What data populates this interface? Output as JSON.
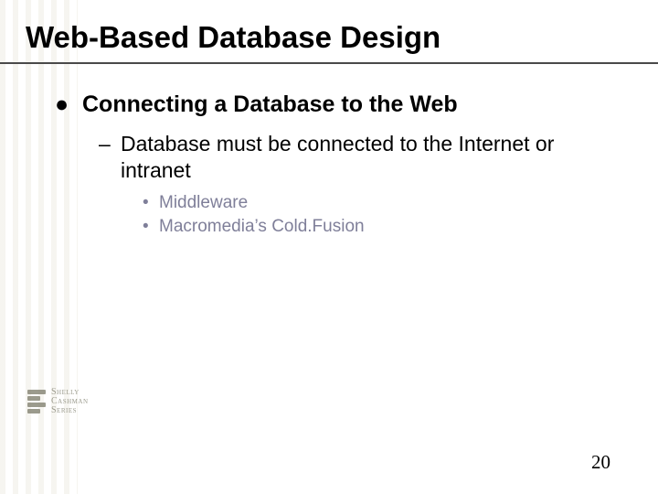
{
  "title": "Web-Based Database Design",
  "content": {
    "lvl1_bullet": "●",
    "lvl1_text": "Connecting a Database to the Web",
    "lvl2_bullet": "–",
    "lvl2_text": "Database must be connected to the Internet or intranet",
    "lvl3_bullet": "•",
    "lvl3a_text": "Middleware",
    "lvl3b_text": "Macromedia’s Cold.Fusion"
  },
  "logo": {
    "line1": "Shelly",
    "line2": "Cashman",
    "line3": "Series"
  },
  "page_number": "20"
}
